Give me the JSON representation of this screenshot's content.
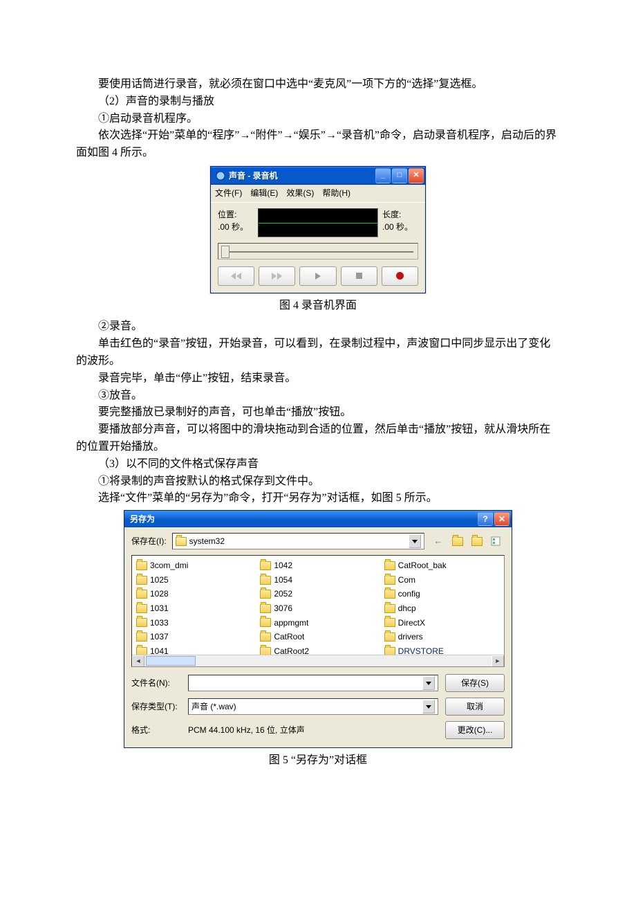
{
  "doc": {
    "p1": "要使用话筒进行录音，就必须在窗口中选中“麦克风”一项下方的“选择”复选框。",
    "p2": "（2）声音的录制与播放",
    "p3": "①启动录音机程序。",
    "p4": "依次选择“开始”菜单的“程序”→“附件”→“娱乐”→“录音机”命令，启动录音机程序，启动后的界面如图 4 所示。",
    "cap1": "图 4   录音机界面",
    "p5": "②录音。",
    "p6": "单击红色的“录音”按钮，开始录音，可以看到，在录制过程中，声波窗口中同步显示出了变化的波形。",
    "p7": "录音完毕，单击“停止”按钮，结束录音。",
    "p8": "③放音。",
    "p9": "要完整播放已录制好的声音，可也单击“播放”按钮。",
    "p10": "要播放部分声音，可以将图中的滑块拖动到合适的位置，然后单击“播放”按钮，就从滑块所在的位置开始播放。",
    "p11": "（3）以不同的文件格式保存声音",
    "p12": "①将录制的声音按默认的格式保存到文件中。",
    "p13": "选择“文件”菜单的“另存为”命令，打开“另存为”对话框，如图 5 所示。",
    "cap2": "图 5   “另存为”对话框"
  },
  "recorder": {
    "title": "声音 - 录音机",
    "menu": {
      "file": "文件(F)",
      "edit": "编辑(E)",
      "effect": "效果(S)",
      "help": "帮助(H)"
    },
    "posLabel": "位置:",
    "posValue": ".00 秒。",
    "lenLabel": "长度:",
    "lenValue": ".00 秒。"
  },
  "saveas": {
    "title": "另存为",
    "saveInLabel": "保存在(I):",
    "location": "system32",
    "cols": [
      [
        "3com_dmi",
        "1025",
        "1028",
        "1031",
        "1033",
        "1037",
        "1041"
      ],
      [
        "1042",
        "1054",
        "2052",
        "3076",
        "appmgmt",
        "CatRoot",
        "CatRoot2"
      ],
      [
        "CatRoot_bak",
        "Com",
        "config",
        "dhcp",
        "DirectX",
        "drivers",
        "DRVSTORE"
      ]
    ],
    "fileNameLabel": "文件名(N):",
    "fileNameValue": "",
    "fileTypeLabel": "保存类型(T):",
    "fileTypeValue": "声音 (*.wav)",
    "formatLabel": "格式:",
    "formatValue": "PCM 44.100 kHz, 16 位, 立体声",
    "btnSave": "保存(S)",
    "btnCancel": "取消",
    "btnChange": "更改(C)..."
  }
}
